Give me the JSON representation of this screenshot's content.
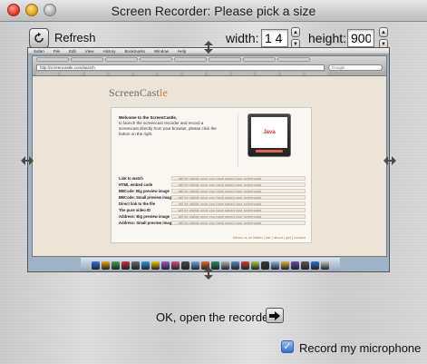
{
  "window": {
    "title": "Screen Recorder: Please pick a size"
  },
  "toolbar": {
    "refresh_label": "Refresh",
    "width_label": "width:",
    "width_value": "1 4",
    "height_label": "height:",
    "height_value": "900"
  },
  "capture": {
    "menubar_items": [
      "Safari",
      "File",
      "Edit",
      "View",
      "History",
      "Bookmarks",
      "Window",
      "Help"
    ],
    "url": "http://screencastle.com/launch",
    "search_placeholder": "Google",
    "logo_main": "ScreenCast",
    "logo_accent": "le",
    "welcome_title": "Welcome to the ScreenCastle,",
    "welcome_text": "to launch the screencast recorder and record a screencast directly from your browser, please click the button on the right.",
    "java_label": "Java",
    "rows": [
      {
        "label": "Link to watch",
        "value": "... will be visible once you have saved your screencast"
      },
      {
        "label": "HTML embed code",
        "value": "... will be visible once you have saved your screencast"
      },
      {
        "label": "BBCode: Big preview image",
        "value": "... will be visible once you have saved your screencast"
      },
      {
        "label": "BBCode: Small preview image",
        "value": "... will be visible once you have saved your screencast"
      },
      {
        "label": "Direct link to the file",
        "value": "... will be visible once you have saved your screencast"
      },
      {
        "label": "The pure video ID",
        "value": "... will be visible once you have saved your screencast"
      },
      {
        "label": "Address: Big preview image",
        "value": "... will be visible once you have saved your screencast"
      },
      {
        "label": "Address: Small preview image",
        "value": "... will be visible once you have saved your screencast"
      }
    ],
    "card_footer": "follow us on twitter | fair | about | get | contact",
    "dock_colors": [
      "#3a6ed8",
      "#e7a11a",
      "#4aa14a",
      "#c8323a",
      "#6b6b6b",
      "#2f9ad6",
      "#f0c419",
      "#9a5bc9",
      "#d14f8b",
      "#4c4c4c",
      "#78a6e0",
      "#e36b2a",
      "#2c8a5f",
      "#b5b5b5",
      "#5d87c9",
      "#cf3d3d",
      "#a7c84a",
      "#3b3b3b",
      "#8fb7e6",
      "#e2b04a",
      "#6d4aa8",
      "#5a5a5a",
      "#2e74c4",
      "#c2c2c2"
    ]
  },
  "actions": {
    "ok_label": "OK, open the recorder",
    "mic_label": "Record my microphone",
    "mic_checked": true
  }
}
